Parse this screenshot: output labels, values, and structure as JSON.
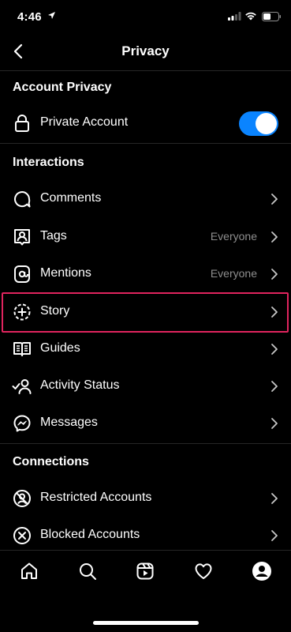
{
  "status_bar": {
    "time": "4:46"
  },
  "header": {
    "title": "Privacy"
  },
  "sections": {
    "account_privacy": {
      "title": "Account Privacy",
      "private_account": {
        "label": "Private Account",
        "enabled": true
      }
    },
    "interactions": {
      "title": "Interactions",
      "items": [
        {
          "label": "Comments",
          "icon": "comment-icon"
        },
        {
          "label": "Tags",
          "value": "Everyone",
          "icon": "tag-person-icon"
        },
        {
          "label": "Mentions",
          "value": "Everyone",
          "icon": "at-icon"
        },
        {
          "label": "Story",
          "icon": "story-add-icon"
        },
        {
          "label": "Guides",
          "icon": "guides-icon"
        },
        {
          "label": "Activity Status",
          "icon": "activity-status-icon"
        },
        {
          "label": "Messages",
          "icon": "messenger-icon"
        }
      ]
    },
    "connections": {
      "title": "Connections",
      "items": [
        {
          "label": "Restricted Accounts",
          "icon": "restricted-icon"
        },
        {
          "label": "Blocked Accounts",
          "icon": "blocked-icon"
        }
      ]
    }
  },
  "tab_bar": [
    "home-icon",
    "search-icon",
    "reels-icon",
    "heart-icon",
    "profile-icon"
  ],
  "colors": {
    "toggle_on": "#0a84ff",
    "highlight": "#e0245e",
    "muted_text": "#8e8e8e"
  }
}
